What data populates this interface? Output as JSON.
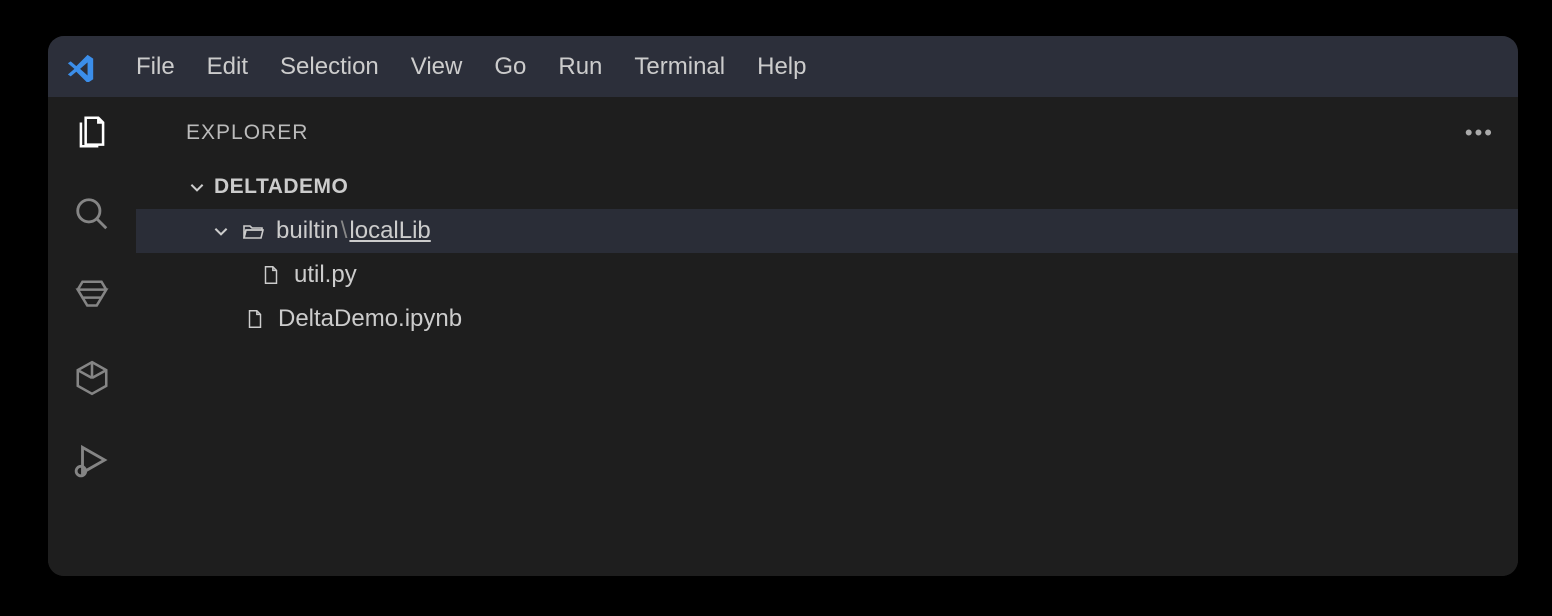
{
  "menu": {
    "items": [
      "File",
      "Edit",
      "Selection",
      "View",
      "Go",
      "Run",
      "Terminal",
      "Help"
    ]
  },
  "sidebar": {
    "title": "EXPLORER",
    "project": "DELTADEMO",
    "folder": {
      "part1": "builtin",
      "sep": "\\",
      "part2": "localLib"
    },
    "files": {
      "f1": "util.py",
      "f2": "DeltaDemo.ipynb"
    }
  }
}
